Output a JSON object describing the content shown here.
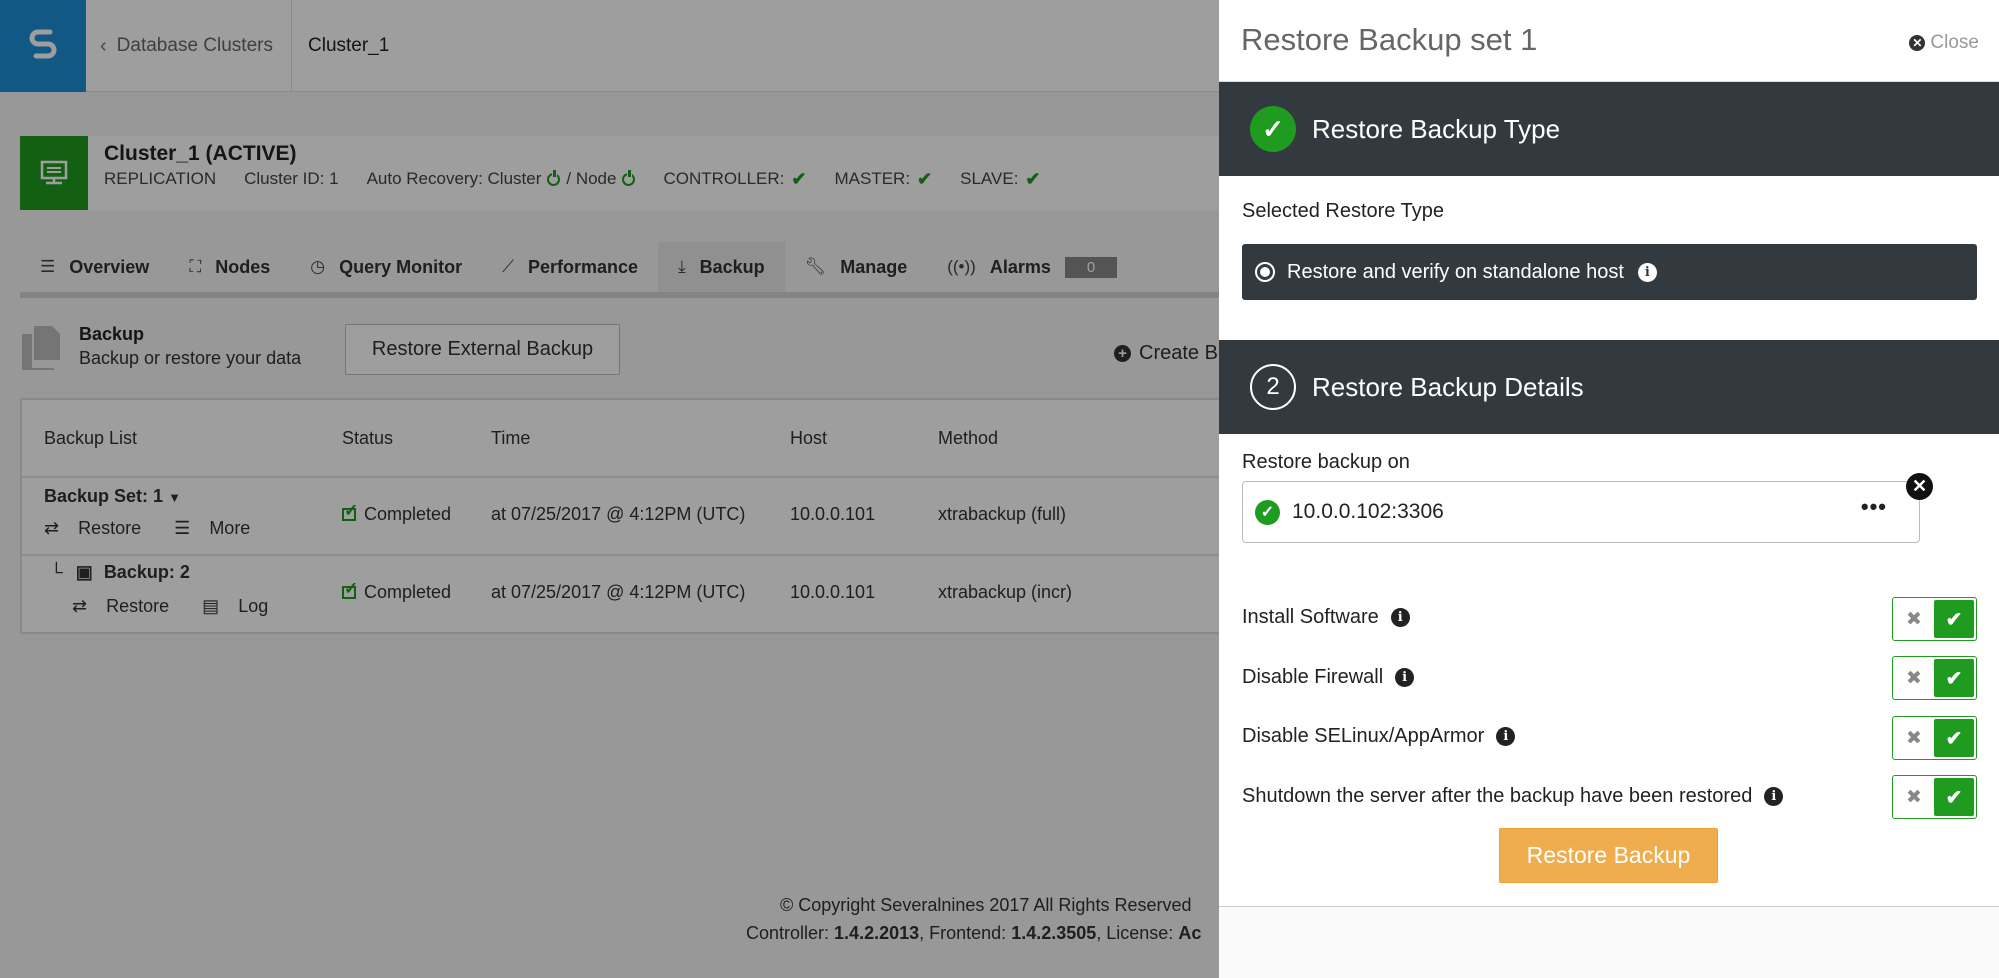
{
  "nav": {
    "back_label": "Database Clusters",
    "current": "Cluster_1"
  },
  "cluster": {
    "title": "Cluster_1 (ACTIVE)",
    "type": "REPLICATION",
    "id_label": "Cluster ID: 1",
    "auto_recovery_label": "Auto Recovery: Cluster",
    "node_label": "/ Node",
    "controller_label": "CONTROLLER:",
    "master_label": "MASTER:",
    "slave_label": "SLAVE:"
  },
  "tabs": [
    {
      "label": "Overview",
      "icon": "list-icon"
    },
    {
      "label": "Nodes",
      "icon": "sitemap-icon"
    },
    {
      "label": "Query Monitor",
      "icon": "gauge-icon"
    },
    {
      "label": "Performance",
      "icon": "line-chart-icon"
    },
    {
      "label": "Backup",
      "icon": "download-icon"
    },
    {
      "label": "Manage",
      "icon": "wrench-icon"
    },
    {
      "label": "Alarms",
      "icon": "broadcast-icon",
      "badge": "0"
    }
  ],
  "backup": {
    "title": "Backup",
    "subtitle": "Backup or restore your data",
    "restore_external_label": "Restore External Backup",
    "create_label": "Create B"
  },
  "table": {
    "headers": [
      "Backup List",
      "Status",
      "Time",
      "Host",
      "Method"
    ],
    "rows": [
      {
        "name": "Backup Set: 1",
        "action1": "Restore",
        "action2": "More",
        "status": "Completed",
        "time": "at 07/25/2017 @ 4:12PM (UTC)",
        "host": "10.0.0.101",
        "method": "xtrabackup (full)"
      },
      {
        "name": "Backup: 2",
        "action1": "Restore",
        "action2": "Log",
        "status": "Completed",
        "time": "at 07/25/2017 @ 4:12PM (UTC)",
        "host": "10.0.0.101",
        "method": "xtrabackup (incr)"
      }
    ]
  },
  "footer": {
    "copyright": "© Copyright Severalnines 2017 All Rights Reserved",
    "controller_label": "Controller:",
    "controller_version": "1.4.2.2013",
    "frontend_label": ", Frontend:",
    "frontend_version": "1.4.2.3505",
    "license_label": ", License:",
    "license_value": "Ac"
  },
  "panel": {
    "title": "Restore Backup set 1",
    "close_label": "Close",
    "section1_title": "Restore Backup Type",
    "selected_type_label": "Selected Restore Type",
    "selected_type_value": "Restore and verify on standalone host",
    "section2_step": "2",
    "section2_title": "Restore Backup Details",
    "restore_on_label": "Restore backup on",
    "restore_on_value": "10.0.0.102:3306",
    "options": [
      {
        "label": "Install Software",
        "enabled": true
      },
      {
        "label": "Disable Firewall",
        "enabled": true
      },
      {
        "label": "Disable SELinux/AppArmor",
        "enabled": true
      },
      {
        "label": "Shutdown the server after the backup have been restored",
        "enabled": true
      }
    ],
    "restore_button_label": "Restore Backup"
  },
  "colors": {
    "brand_blue": "#1e8fd6",
    "success_green": "#1f9c1f",
    "section_dark": "#333a3f",
    "warning_orange": "#f0ad4e"
  }
}
